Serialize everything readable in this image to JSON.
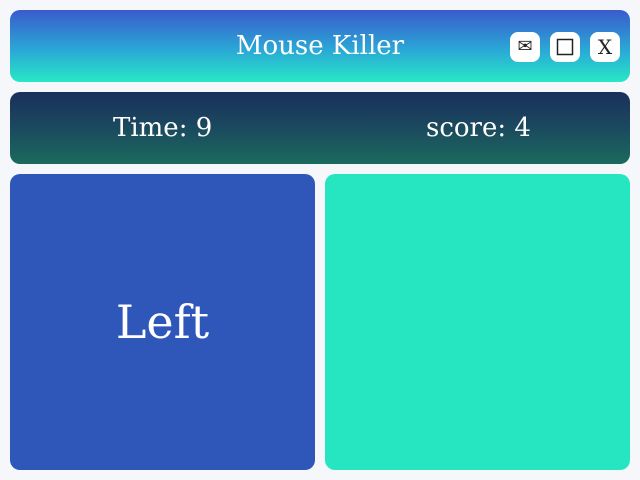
{
  "window": {
    "title": "Mouse Killer",
    "buttons": [
      {
        "name": "mail",
        "glyph": "✉",
        "icon": "envelope-icon"
      },
      {
        "name": "maximize",
        "glyph": "",
        "icon": "square-icon"
      },
      {
        "name": "close",
        "glyph": "X",
        "icon": "close-icon"
      }
    ]
  },
  "status": {
    "time_text": "Time: 9",
    "score_text": "score: 4"
  },
  "game": {
    "left_label": "Left",
    "right_label": ""
  },
  "colors": {
    "left_panel": "#2f57ba",
    "right_panel": "#26e6c2",
    "title_gradient_top": "#3a5bcc",
    "title_gradient_bottom": "#27e8c6",
    "status_gradient_top": "#1a2f5c",
    "status_gradient_bottom": "#1b6a5e"
  }
}
